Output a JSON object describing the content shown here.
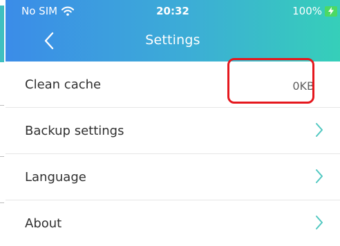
{
  "status_bar": {
    "carrier": "No SIM",
    "wifi_icon": "wifi-icon",
    "time": "20:32",
    "battery": "100%",
    "battery_icon": "battery-charging-icon"
  },
  "nav_bar": {
    "back_icon": "chevron-left-icon",
    "title": "Settings"
  },
  "settings": {
    "items": [
      {
        "label": "Clean cache",
        "value": "0KB"
      },
      {
        "label": "Backup settings",
        "icon": "chevron-right-icon"
      },
      {
        "label": "Language",
        "icon": "chevron-right-icon"
      },
      {
        "label": "About",
        "icon": "chevron-right-icon"
      }
    ]
  },
  "colors": {
    "header_gradient_start": "#3b8ce8",
    "header_gradient_end": "#36cfb9",
    "chevron": "#4fc7c0",
    "highlight": "#e5171d",
    "battery": "#4cd964"
  }
}
